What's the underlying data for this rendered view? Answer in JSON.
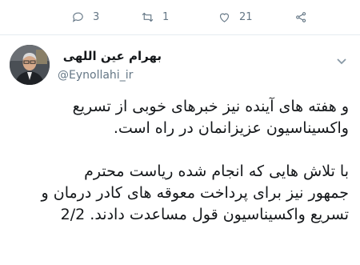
{
  "tweet": {
    "actions": {
      "reply_count": "3",
      "retweet_count": "1",
      "like_count": "21"
    },
    "author": {
      "name": "بهرام عین اللهی",
      "handle": "@Eynollahi_ir"
    },
    "text_lines": [
      "و هفته های آینده نیز خبرهای خوبی از تسریع",
      "واکسیناسیون عزیزانمان در راه است.",
      "",
      "با تلاش هایی که انجام شده ریاست محترم",
      "جمهور نیز برای پرداخت معوقه های کادر درمان و",
      "تسریع واکسیناسیون قول مساعدت دادند. 2/2"
    ]
  },
  "colors": {
    "text": "#14171a",
    "muted": "#657786",
    "divider": "#e6ecf0"
  }
}
